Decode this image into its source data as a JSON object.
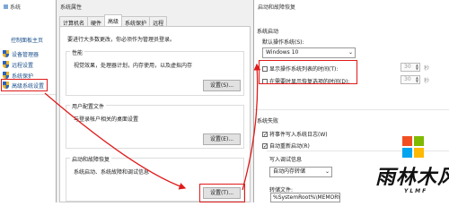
{
  "system_window": {
    "title": "系统",
    "home_link": "控制面板主页",
    "nav": [
      {
        "label": "设备管理器",
        "icon": "shield-icon"
      },
      {
        "label": "远程设置",
        "icon": "shield-icon"
      },
      {
        "label": "系统保护",
        "icon": "shield-icon"
      },
      {
        "label": "高级系统设置",
        "icon": "shield-icon"
      }
    ]
  },
  "props_window": {
    "title": "系统属性",
    "tabs": [
      "计算机名",
      "硬件",
      "高级",
      "系统保护",
      "远程"
    ],
    "active_tab": "高级",
    "note": "要进行大多数更改，你必须作为管理员登录。",
    "performance": {
      "title": "性能",
      "desc": "视觉效果，处理器计划，内存使用，以及虚拟内存",
      "button": "设置(S)..."
    },
    "user_profiles": {
      "title": "用户配置文件",
      "desc": "与登录帐户相关的桌面设置",
      "button": "设置(E)..."
    },
    "startup": {
      "title": "启动和故障恢复",
      "desc": "系统启动、系统故障和调试信息",
      "button": "设置(T)..."
    }
  },
  "recovery_window": {
    "title": "启动和故障恢复",
    "system_startup": "系统启动",
    "default_os_label": "默认操作系统(S):",
    "default_os_value": "Windows 10",
    "show_os_list": {
      "label": "显示操作系统列表的时间(T):",
      "checked": false,
      "value": "30",
      "unit": "秒"
    },
    "show_recovery": {
      "label": "在需要时显示恢复选项的时间(D):",
      "checked": false,
      "value": "30",
      "unit": "秒"
    },
    "system_failure": "系统失败",
    "write_event": {
      "label": "将事件写入系统日志(W)",
      "checked": true
    },
    "auto_restart": {
      "label": "自动重新启动(R)",
      "checked": true
    },
    "debug_info": "写入调试信息",
    "debug_select": "自动内存转储",
    "dump_file_label": "转储文件:",
    "dump_file_value": "%SystemRoot%\\MEMORY.DMP"
  },
  "watermark": {
    "text": "雨林木风",
    "sub": "YLMF"
  },
  "colors": {
    "highlight": "#e01a1a",
    "link": "#1a4f8a",
    "logo": [
      "#f25022",
      "#7fba00",
      "#00a4ef",
      "#ffb900"
    ]
  }
}
